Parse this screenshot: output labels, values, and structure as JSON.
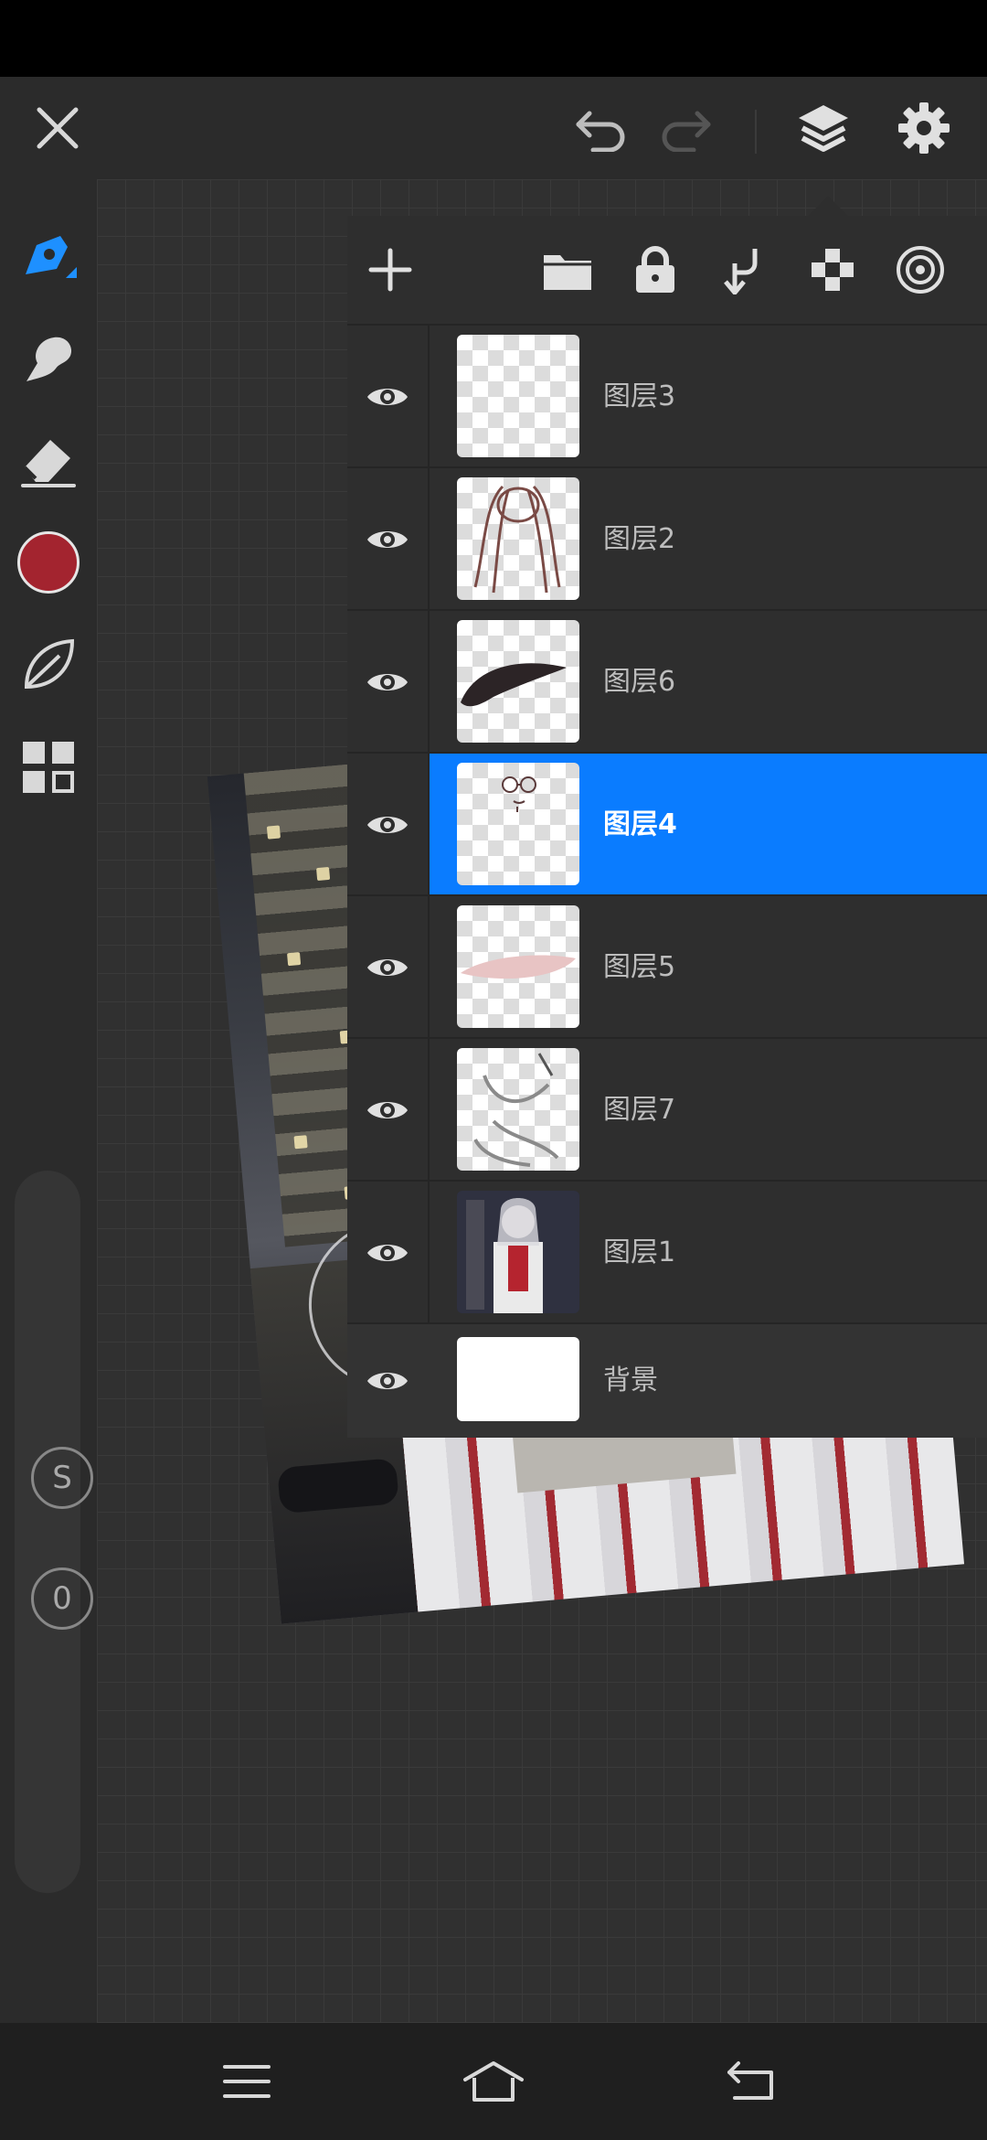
{
  "app": {
    "accent_color": "#0a7cff",
    "current_color": "#a3242f"
  },
  "top_bar": {
    "icons": [
      "close-icon",
      "undo-icon",
      "redo-icon",
      "layers-icon",
      "gear-icon"
    ]
  },
  "left_toolbar": {
    "tools": [
      "brush-icon",
      "smudge-icon",
      "eraser-icon",
      "color-swatch",
      "leaf-icon",
      "grid-icon"
    ],
    "size_knob_label": "S",
    "opacity_knob_label": "0"
  },
  "layers_panel": {
    "toolbar_icons": [
      "add-icon",
      "folder-icon",
      "lock-icon",
      "merge-down-icon",
      "checker-icon",
      "target-icon"
    ],
    "layers": [
      {
        "name": "图层3",
        "visible": true,
        "selected": false,
        "thumb": "empty"
      },
      {
        "name": "图层2",
        "visible": true,
        "selected": false,
        "thumb": "hair-sketch"
      },
      {
        "name": "图层6",
        "visible": true,
        "selected": false,
        "thumb": "dark-stroke"
      },
      {
        "name": "图层4",
        "visible": true,
        "selected": true,
        "thumb": "face-sketch"
      },
      {
        "name": "图层5",
        "visible": true,
        "selected": false,
        "thumb": "pink-stroke"
      },
      {
        "name": "图层7",
        "visible": true,
        "selected": false,
        "thumb": "grey-sketch"
      },
      {
        "name": "图层1",
        "visible": true,
        "selected": false,
        "thumb": "photo"
      }
    ],
    "background_layer": {
      "name": "背景",
      "visible": true
    }
  },
  "nav_bar": {
    "icons": [
      "menu-icon",
      "home-icon",
      "back-icon"
    ]
  }
}
